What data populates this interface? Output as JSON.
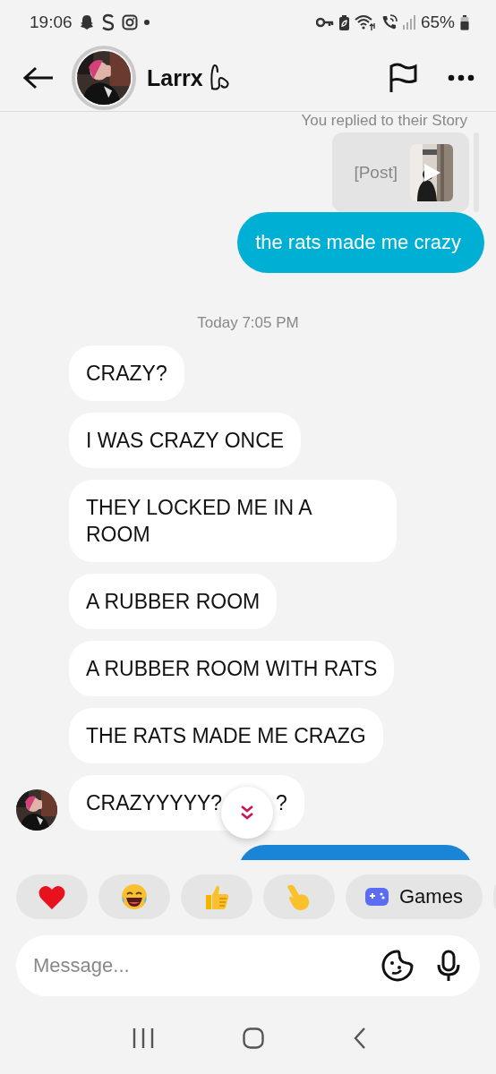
{
  "status_bar": {
    "time": "19:06",
    "battery": "65%"
  },
  "header": {
    "name": "Larrx"
  },
  "thread": {
    "story_reply": {
      "caption": "You replied to their Story",
      "label": "[Post]"
    },
    "messages": [
      {
        "kind": "outgoing",
        "text": "the rats made me crazy"
      },
      {
        "kind": "timestamp",
        "text": "Today 7:05 PM"
      },
      {
        "kind": "incoming",
        "text": "CRAZY?",
        "avatar": false
      },
      {
        "kind": "incoming",
        "text": "I WAS CRAZY ONCE",
        "avatar": false
      },
      {
        "kind": "incoming",
        "text": "THEY LOCKED ME IN A ROOM",
        "avatar": false
      },
      {
        "kind": "incoming",
        "text": "A RUBBER ROOM",
        "avatar": false
      },
      {
        "kind": "incoming",
        "text": "A RUBBER ROOM WITH RATS",
        "avatar": false
      },
      {
        "kind": "incoming",
        "text": "THE RATS MADE ME CRAZG",
        "avatar": false
      },
      {
        "kind": "incoming",
        "parts": [
          "CRAZYYYYY?",
          "?"
        ],
        "avatar": true
      },
      {
        "kind": "outgoing_partial"
      }
    ]
  },
  "quick_replies": [
    {
      "kind": "heart"
    },
    {
      "kind": "laugh"
    },
    {
      "kind": "thumbs"
    },
    {
      "kind": "point"
    },
    {
      "kind": "games",
      "label": "Games"
    },
    {
      "kind": "partial"
    }
  ],
  "composer": {
    "placeholder": "Message..."
  }
}
